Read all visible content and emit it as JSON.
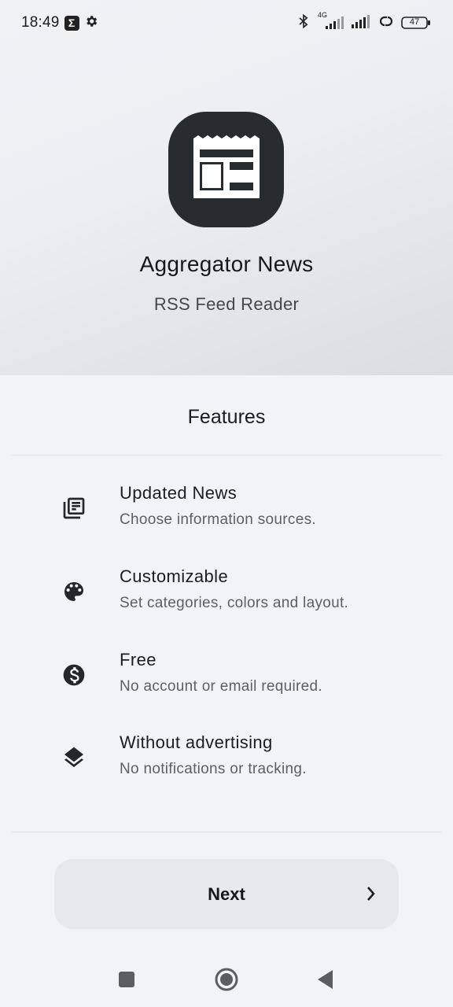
{
  "status_bar": {
    "time": "18:49",
    "network_label": "4G",
    "battery": "47",
    "icons": [
      "sigma-icon",
      "gear-icon",
      "bluetooth-icon",
      "signal-4g-icon",
      "signal-icon",
      "hotspot-icon",
      "battery-icon"
    ]
  },
  "app": {
    "title": "Aggregator News",
    "subtitle": "RSS Feed Reader",
    "icon": "newspaper-icon",
    "icon_bg_color": "#262c2f"
  },
  "features": {
    "heading": "Features",
    "items": [
      {
        "icon": "news-list-icon",
        "title": "Updated News",
        "description": "Choose information sources."
      },
      {
        "icon": "palette-icon",
        "title": "Customizable",
        "description": "Set categories, colors and layout."
      },
      {
        "icon": "dollar-icon",
        "title": "Free",
        "description": "No account or email required."
      },
      {
        "icon": "layers-icon",
        "title": "Without advertising",
        "description": "No notifications or tracking."
      }
    ]
  },
  "next_button": {
    "label": "Next",
    "icon": "chevron-right-icon"
  },
  "nav_bar": {
    "icons": [
      "recents-icon",
      "home-icon",
      "back-icon"
    ]
  }
}
